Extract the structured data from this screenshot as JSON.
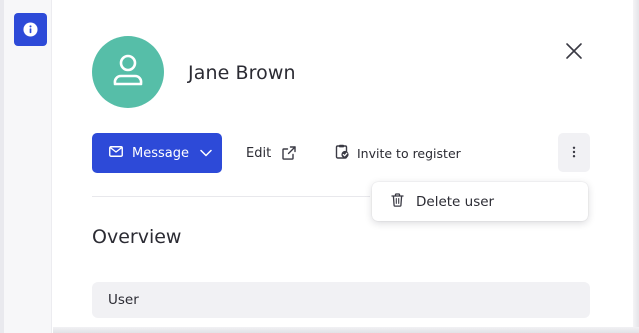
{
  "sidebar": {
    "info_icon": "info-icon"
  },
  "profile": {
    "name": "Jane Brown",
    "avatar_icon": "user-icon",
    "avatar_color": "#56bea8"
  },
  "toolbar": {
    "message_label": "Message",
    "edit_label": "Edit",
    "invite_label": "Invite to register",
    "more_icon": "more-vertical-icon",
    "accent_color": "#2d4ad8"
  },
  "menu": {
    "items": [
      {
        "label": "Delete user",
        "icon": "trash-icon"
      }
    ]
  },
  "overview": {
    "title": "Overview",
    "group_label": "User"
  }
}
